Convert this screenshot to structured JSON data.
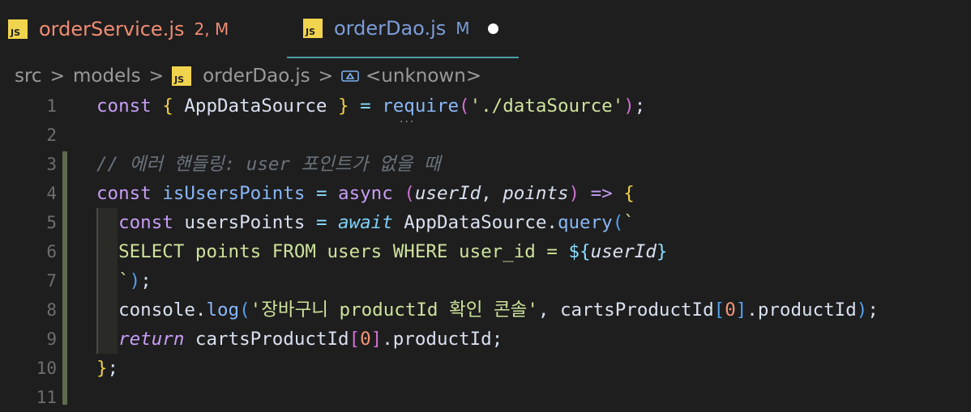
{
  "tabs": [
    {
      "file": "orderService.js",
      "status": "2, M",
      "icon": "js-file-icon",
      "icon_text": "JS",
      "active": false
    },
    {
      "file": "orderDao.js",
      "status": "M",
      "icon": "js-file-icon",
      "icon_text": "JS",
      "active": true,
      "dirty_dot": "unsaved-dot-icon"
    }
  ],
  "breadcrumb": {
    "segments": [
      "src",
      "models",
      "orderDao.js",
      "<unknown>"
    ],
    "separator": ">",
    "file_icon_text": "JS",
    "symbol_icon": "symbol-variable-icon"
  },
  "editor": {
    "line_numbers": [
      "1",
      "2",
      "3",
      "4",
      "5",
      "6",
      "7",
      "8",
      "9",
      "10",
      "11"
    ],
    "lines": [
      {
        "tokens": [
          [
            "kw",
            "const"
          ],
          [
            "plain",
            " "
          ],
          [
            "brace-y",
            "{"
          ],
          [
            "var",
            " AppDataSource "
          ],
          [
            "brace-y",
            "}"
          ],
          [
            "plain",
            " "
          ],
          [
            "op",
            "="
          ],
          [
            "plain",
            " "
          ],
          [
            "fn",
            "require"
          ],
          [
            "brace-p",
            "("
          ],
          [
            "str",
            "'./dataSource'"
          ],
          [
            "brace-p",
            ")"
          ],
          [
            "plain",
            ";"
          ]
        ]
      },
      {
        "tokens": []
      },
      {
        "tokens": [
          [
            "cmt",
            "// 에러 핸들링: user 포인트가 없을 때"
          ]
        ]
      },
      {
        "tokens": [
          [
            "kw",
            "const"
          ],
          [
            "plain",
            " "
          ],
          [
            "fn",
            "isUsersPoints"
          ],
          [
            "plain",
            " "
          ],
          [
            "op",
            "="
          ],
          [
            "plain",
            " "
          ],
          [
            "kw",
            "async"
          ],
          [
            "plain",
            " "
          ],
          [
            "brace-p",
            "("
          ],
          [
            "param",
            "userId"
          ],
          [
            "plain",
            ", "
          ],
          [
            "param",
            "points"
          ],
          [
            "brace-p",
            ")"
          ],
          [
            "plain",
            " "
          ],
          [
            "kw",
            "=>"
          ],
          [
            "plain",
            " "
          ],
          [
            "brace-y",
            "{"
          ]
        ]
      },
      {
        "tokens": [
          [
            "plain",
            "  "
          ],
          [
            "kw",
            "const"
          ],
          [
            "var",
            " usersPoints "
          ],
          [
            "op",
            "="
          ],
          [
            "plain",
            " "
          ],
          [
            "await-kw",
            "await"
          ],
          [
            "var",
            " AppDataSource"
          ],
          [
            "plain",
            "."
          ],
          [
            "fn",
            "query"
          ],
          [
            "brace-b",
            "("
          ],
          [
            "str",
            "`"
          ]
        ]
      },
      {
        "tokens": [
          [
            "plain",
            "  "
          ],
          [
            "sql",
            "SELECT points FROM users WHERE user_id = "
          ],
          [
            "tmpl",
            "${"
          ],
          [
            "param",
            "userId"
          ],
          [
            "tmpl",
            "}"
          ]
        ]
      },
      {
        "tokens": [
          [
            "plain",
            "  "
          ],
          [
            "str",
            "`"
          ],
          [
            "brace-b",
            ")"
          ],
          [
            "plain",
            ";"
          ]
        ]
      },
      {
        "tokens": [
          [
            "plain",
            "  "
          ],
          [
            "var",
            "console"
          ],
          [
            "plain",
            "."
          ],
          [
            "fn",
            "log"
          ],
          [
            "brace-b",
            "("
          ],
          [
            "str",
            "'장바구니 productId 확인 콘솔'"
          ],
          [
            "plain",
            ", "
          ],
          [
            "var",
            "cartsProductId"
          ],
          [
            "brace-b",
            "["
          ],
          [
            "num",
            "0"
          ],
          [
            "brace-b",
            "]"
          ],
          [
            "plain",
            "."
          ],
          [
            "var",
            "productId"
          ],
          [
            "brace-b",
            ")"
          ],
          [
            "plain",
            ";"
          ]
        ]
      },
      {
        "tokens": [
          [
            "plain",
            "  "
          ],
          [
            "ctrl",
            "return"
          ],
          [
            "var",
            " cartsProductId"
          ],
          [
            "brace-p",
            "["
          ],
          [
            "num",
            "0"
          ],
          [
            "brace-p",
            "]"
          ],
          [
            "plain",
            "."
          ],
          [
            "var",
            "productId"
          ],
          [
            "plain",
            ";"
          ]
        ]
      },
      {
        "tokens": [
          [
            "brace-y",
            "}"
          ],
          [
            "plain",
            ";"
          ]
        ]
      },
      {
        "tokens": []
      }
    ]
  },
  "colors": {
    "background": "#1e1e1e",
    "active_tab_border": "#4d9ea7",
    "js_icon": "#f1d44d"
  }
}
